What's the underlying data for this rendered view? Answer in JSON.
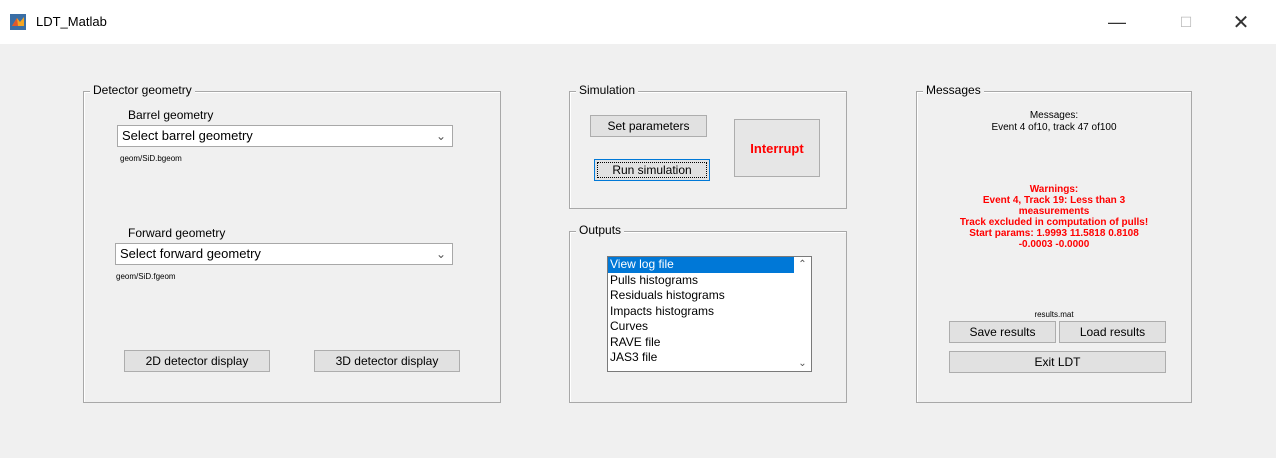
{
  "window": {
    "title": "LDT_Matlab",
    "minimize": "—",
    "maximize": "☐",
    "close": "✕"
  },
  "detector": {
    "panel_title": "Detector geometry",
    "barrel_label": "Barrel geometry",
    "barrel_select": "Select barrel geometry",
    "barrel_file": "geom/SiD.bgeom",
    "forward_label": "Forward geometry",
    "forward_select": "Select forward geometry",
    "forward_file": "geom/SiD.fgeom",
    "btn_2d": "2D detector display",
    "btn_3d": "3D detector display"
  },
  "simulation": {
    "panel_title": "Simulation",
    "set_params": "Set parameters",
    "run": "Run simulation",
    "interrupt": "Interrupt"
  },
  "outputs": {
    "panel_title": "Outputs",
    "items": [
      "View log file",
      "Pulls histograms",
      "Residuals histograms",
      "Impacts histograms",
      "Curves",
      "RAVE file",
      "JAS3 file"
    ],
    "selected_index": 0
  },
  "messages": {
    "panel_title": "Messages",
    "heading": "Messages:",
    "status": "Event 4 of10, track 47 of100",
    "warn_heading": "Warnings:",
    "warn_lines": [
      "Event 4, Track 19: Less than 3",
      "measurements",
      "Track excluded in computation of pulls!",
      "Start params: 1.9993 11.5818  0.8108",
      "-0.0003 -0.0000"
    ],
    "results_file": "results.mat",
    "save": "Save results",
    "load": "Load results",
    "exit": "Exit LDT"
  },
  "colors": {
    "warning": "#ff0000",
    "selection": "#0078d7"
  }
}
